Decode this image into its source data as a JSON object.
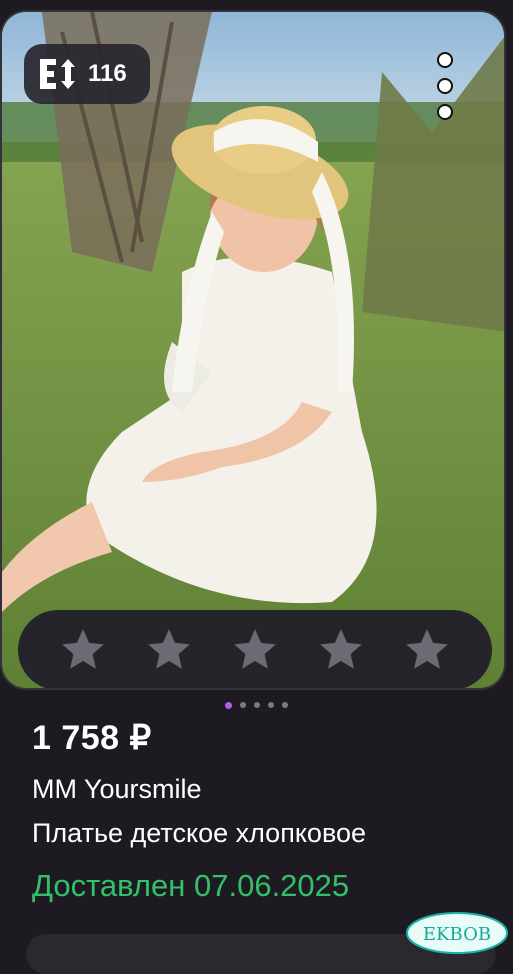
{
  "product": {
    "size_badge": {
      "count": "116",
      "icon": "size-arrows-icon"
    },
    "rating": {
      "stars_total": 5,
      "stars_filled": 0
    },
    "carousel": {
      "total": 5,
      "active": 1
    },
    "price": "1 758 ₽",
    "brand": "MM Yoursmile",
    "title": "Платье детское хлопковое",
    "status": "Доставлен 07.06.2025"
  },
  "watermark": {
    "text": "EKBOB"
  },
  "colors": {
    "background": "#1d1b21",
    "status_green": "#32c06a",
    "carousel_active": "#b05de8",
    "star_empty": "#6d6a73"
  }
}
